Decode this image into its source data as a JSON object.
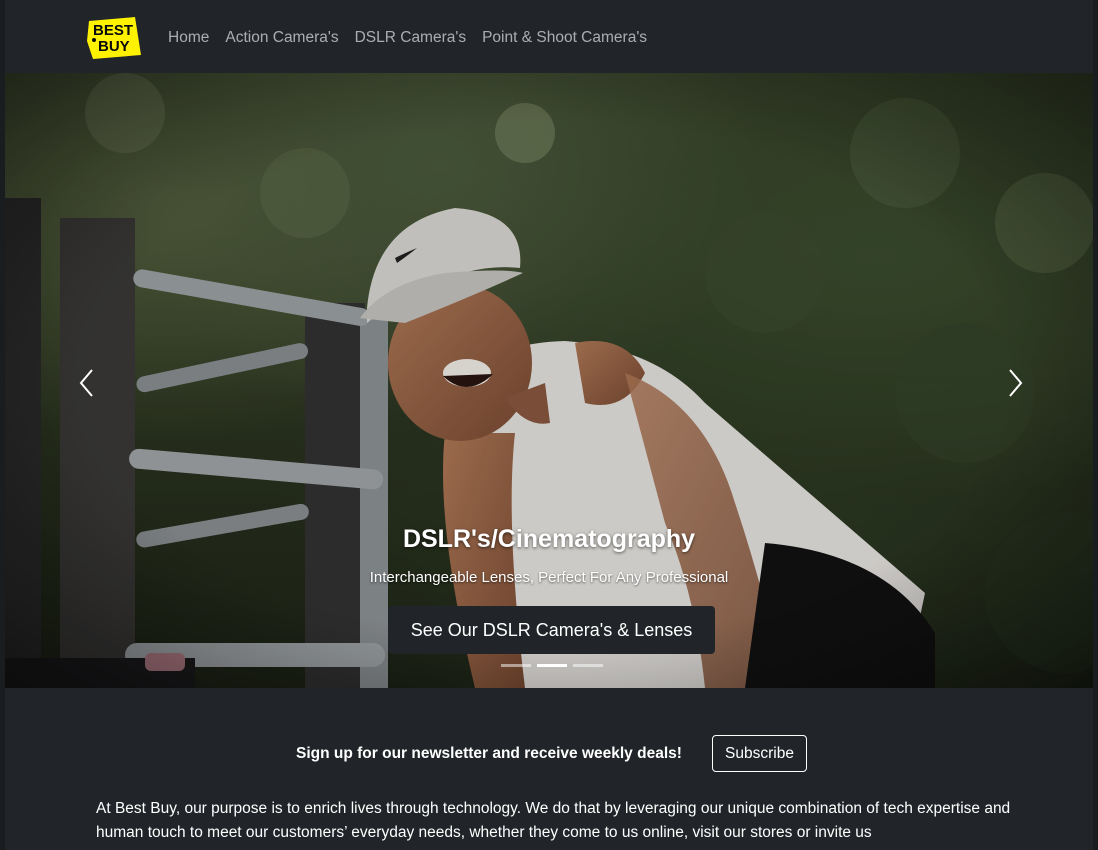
{
  "brand": {
    "name": "Best Buy",
    "logo_line1": "BEST",
    "logo_line2": "BUY",
    "colors": {
      "logo_bg": "#fff200",
      "logo_text": "#0a0a0a",
      "nav_bg": "#212529"
    }
  },
  "nav": {
    "items": [
      {
        "label": "Home"
      },
      {
        "label": "Action Camera's"
      },
      {
        "label": "DSLR Camera's"
      },
      {
        "label": "Point & Shoot Camera's"
      }
    ]
  },
  "carousel": {
    "title": "DSLR's/Cinematography",
    "subtitle": "Interchangeable Lenses, Perfect For Any Professional",
    "button_label": "See Our DSLR Camera's & Lenses",
    "slide_count": 3,
    "active_slide": 2,
    "prev_icon": "chevron-left-icon",
    "next_icon": "chevron-right-icon"
  },
  "newsletter": {
    "text": "Sign up for our newsletter and receive weekly deals!",
    "button_label": "Subscribe"
  },
  "about": {
    "text": "At Best Buy, our purpose is to enrich lives through technology. We do that by leveraging our unique combination of tech expertise and human touch to meet our customers’ everyday needs, whether they come to us online, visit our stores or invite us"
  }
}
